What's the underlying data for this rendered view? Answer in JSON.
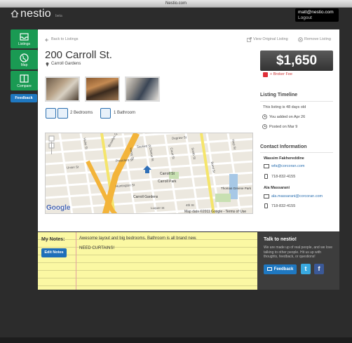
{
  "window": {
    "title": "Nestio.com"
  },
  "brand": {
    "name": "nestio",
    "tag": "beta"
  },
  "user": {
    "email": "matt@nestio.com",
    "logout": "Logout"
  },
  "sidebar": {
    "items": [
      {
        "label": "Listings",
        "icon": "inbox-icon"
      },
      {
        "label": "Map",
        "icon": "globe-icon"
      },
      {
        "label": "Compare",
        "icon": "columns-icon"
      }
    ],
    "feedback": "Feedback"
  },
  "toolbar": {
    "back": "Back to Listings",
    "view_original": "View Original Listing",
    "remove": "Remove Listing"
  },
  "listing": {
    "address": "200 Carroll St.",
    "neighborhood": "Carroll Gardens",
    "bedrooms": "2 Bedrooms",
    "bathrooms": "1 Bathroom",
    "price": "$1,650",
    "broker_fee": "+ Broker Fee"
  },
  "timeline": {
    "title": "Listing Timeline",
    "age": "This listing is 48 days old",
    "added": "You added on Apr 26",
    "posted": "Posted on Mar 9"
  },
  "contact": {
    "title": "Contact Information",
    "people": [
      {
        "name": "Wassim Fakhereddine",
        "email": "wfa@corcoran.com",
        "phone": "718-832-4155"
      },
      {
        "name": "Ala Massarani",
        "email": "ala.massarani@corcoran.com",
        "phone": "718-832-4155"
      }
    ]
  },
  "map": {
    "attribution": "Map data ©2011 Google - Terms of Use",
    "google": "Google",
    "labels": [
      "Carroll St",
      "Carroll Park",
      "Carroll Gardens",
      "Brooklyn Queens Expy",
      "Smith St",
      "Court St",
      "Clinton St",
      "President St",
      "Sackett St",
      "Degraw St",
      "Union St",
      "Bond St",
      "Hoyt St",
      "Thomas Greene Park",
      "4th St",
      "Luquer St",
      "Huntington St",
      "Henry St",
      "Hicks St"
    ]
  },
  "notes": {
    "label": "My Notes:",
    "lines": [
      "Awesome layout and big bedrooms. Bathroom is all brand new.",
      "NEED CURTAINS!"
    ],
    "edit": "Edit Notes"
  },
  "talk": {
    "title": "Talk to nestio!",
    "description": "We are made up of real people, and we love talking to other people. Hit us up with thoughts, feedback, or questions!",
    "feedback": "Feedback"
  }
}
